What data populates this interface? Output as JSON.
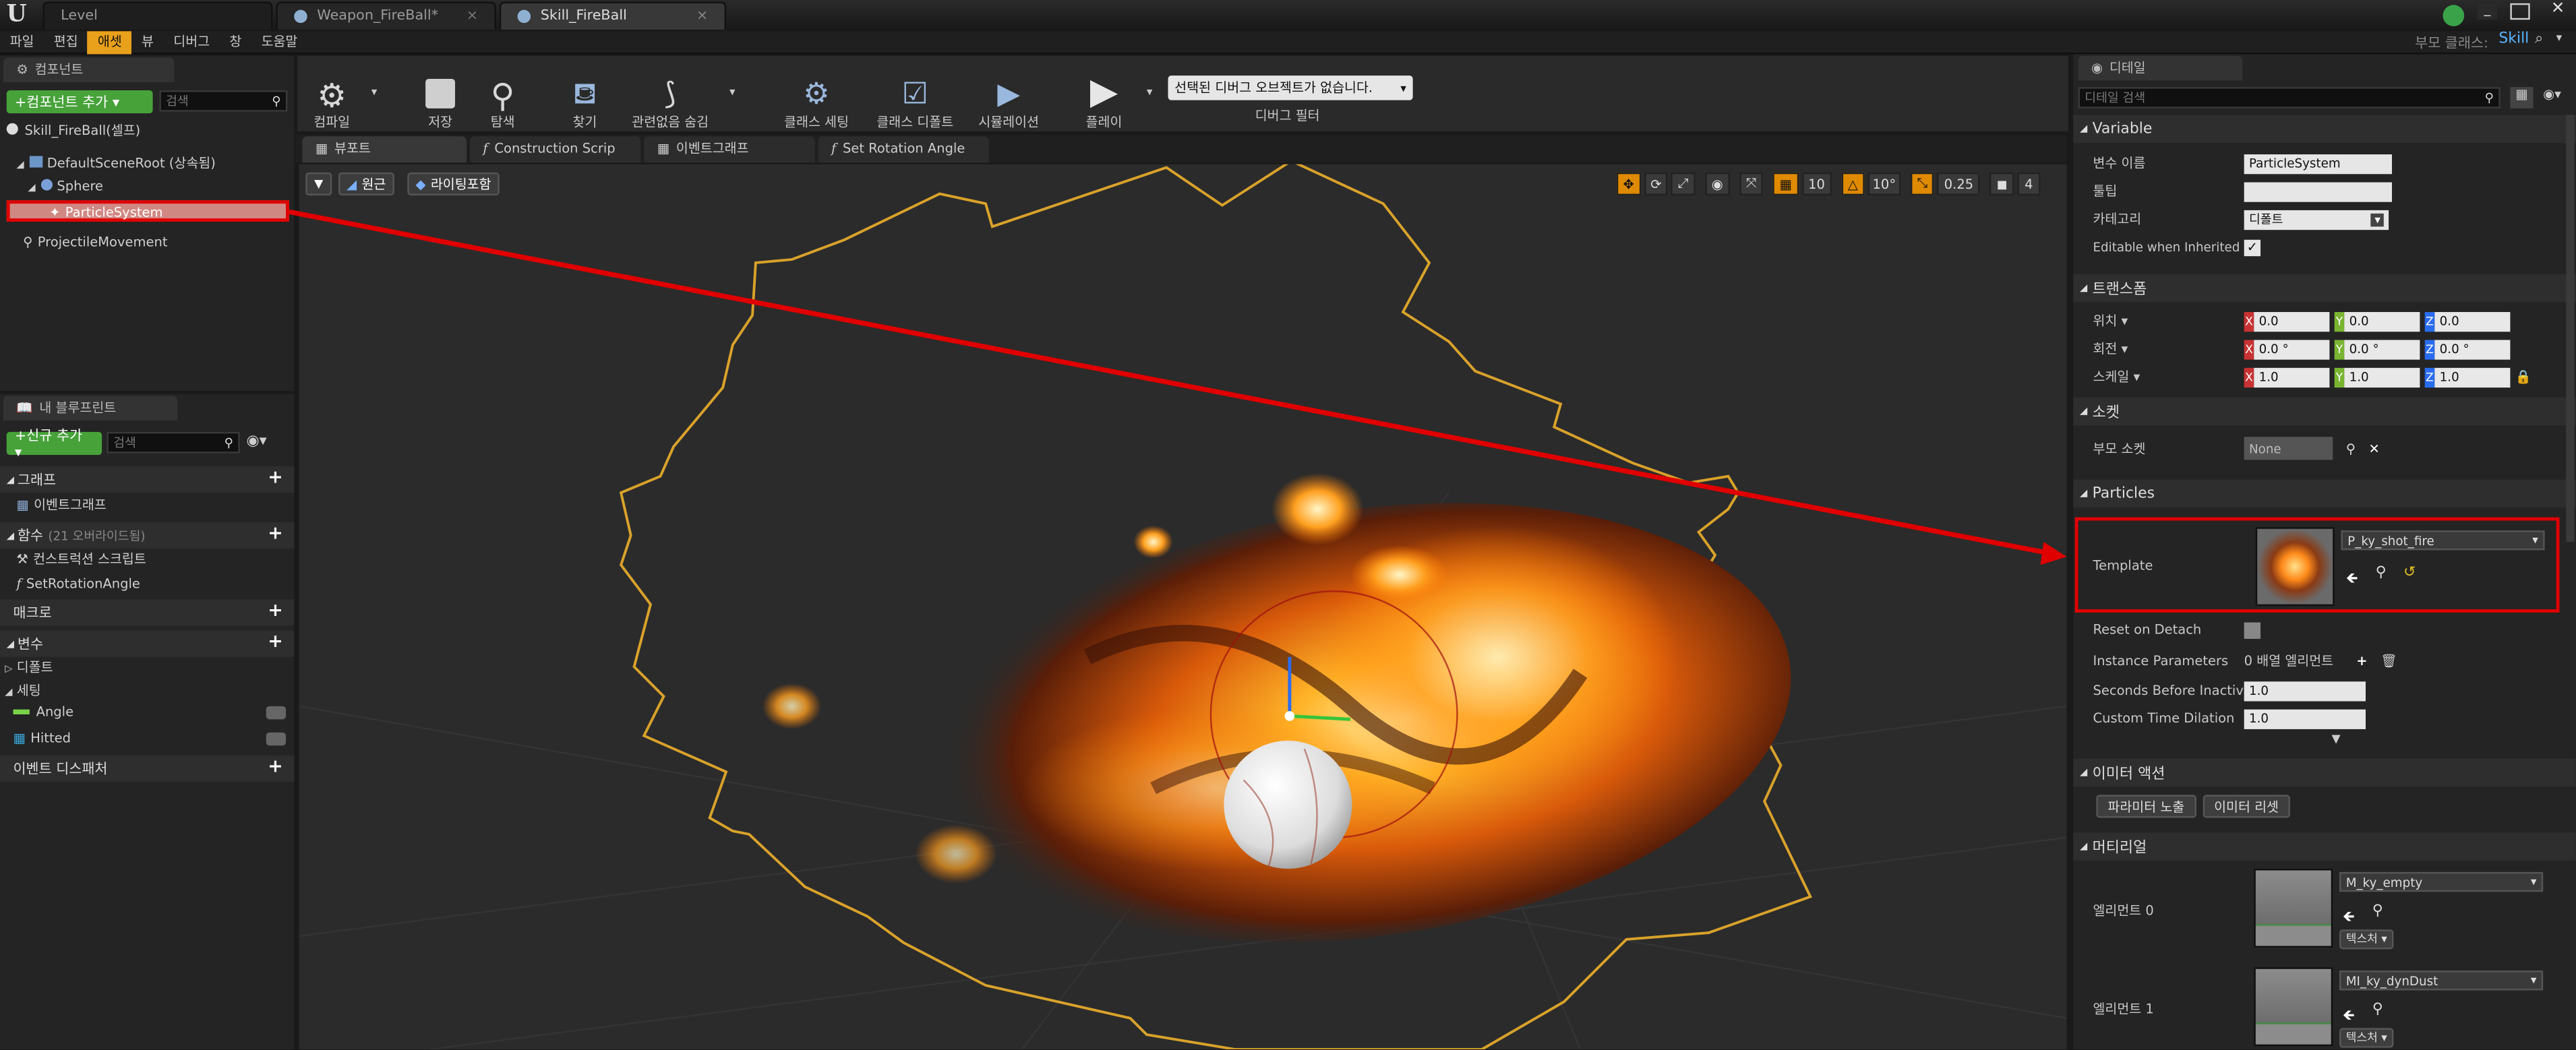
{
  "app": {
    "logo": "U"
  },
  "tabs": [
    {
      "label": "Level"
    },
    {
      "label": "Weapon_FireBall*"
    },
    {
      "label": "Skill_FireBall"
    }
  ],
  "window": {
    "parent_class_label": "부모 클래스:",
    "parent_class_value": "Skill"
  },
  "menu": [
    "파일",
    "편집",
    "애셋",
    "뷰",
    "디버그",
    "창",
    "도움말"
  ],
  "components": {
    "tab_label": "컴포넌트",
    "add_button": "+컴포넌트 추가 ▾",
    "search_placeholder": "검색",
    "self_item": "Skill_FireBall(셀프)",
    "tree": [
      "DefaultSceneRoot (상속됨)",
      "Sphere",
      "ParticleSystem",
      "ProjectileMovement"
    ]
  },
  "my_blueprint": {
    "tab_label": "내 블루프린트",
    "add_button": "+신규 추가 ▾",
    "search_placeholder": "검색",
    "graph_section": "그래프",
    "event_graph": "이벤트그래프",
    "functions_section": "함수",
    "functions_override": "(21 오버라이드됨)",
    "construction_script": "컨스트럭션 스크립트",
    "set_rotation_angle": "SetRotationAngle",
    "macros_section": "매크로",
    "variables_section": "변수",
    "default_category": "디폴트",
    "setting_category": "세팅",
    "vars": [
      "Angle",
      "Hitted"
    ],
    "dispatchers_section": "이벤트 디스패처"
  },
  "toolbar": {
    "compile": "컴파일",
    "save": "저장",
    "browse": "탐색",
    "find": "찾기",
    "hide_unrelated": "관련없음 숨김",
    "class_settings": "클래스 세팅",
    "class_defaults": "클래스 디폴트",
    "simulation": "시뮬레이션",
    "play": "플레이",
    "debug_select": "선택된 디버그 오브젝트가 없습니다.",
    "debug_filter": "디버그 필터"
  },
  "editor_tabs": [
    "뷰포트",
    "Construction Scrip",
    "이벤트그래프",
    "Set Rotation Angle"
  ],
  "viewport": {
    "perspective": "원근",
    "lit": "라이팅포함",
    "grid_snap": "10",
    "rot_snap": "10°",
    "scale_snap": "0.25",
    "cam_speed": "4"
  },
  "details": {
    "tab_label": "디테일",
    "search_placeholder": "디테일 검색",
    "variable_section": "Variable",
    "var_name_label": "변수 이름",
    "var_name_value": "ParticleSystem",
    "tooltip_label": "툴팁",
    "category_label": "카테고리",
    "category_value": "디폴트",
    "editable_label": "Editable when Inherited",
    "transform_section": "트랜스폼",
    "location_label": "위치 ▾",
    "rotation_label": "회전 ▾",
    "scale_label": "스케일 ▾",
    "location": [
      "0.0",
      "0.0",
      "0.0"
    ],
    "rotation": [
      "0.0 °",
      "0.0 °",
      "0.0 °"
    ],
    "scale": [
      "1.0",
      "1.0",
      "1.0"
    ],
    "socket_section": "소켓",
    "parent_socket_label": "부모 소켓",
    "parent_socket_value": "None",
    "particles_section": "Particles",
    "template_label": "Template",
    "template_value": "P_ky_shot_fire",
    "reset_detach_label": "Reset on Detach",
    "instance_params_label": "Instance Parameters",
    "instance_params_value": "0 배열 엘리먼트",
    "seconds_inactive_label": "Seconds Before Inactive",
    "seconds_inactive_value": "1.0",
    "time_dilation_label": "Custom Time Dilation",
    "time_dilation_value": "1.0",
    "emitter_section": "이미터 액션",
    "expose_params": "파라미터 노출",
    "reset_emitter": "이미터 리셋",
    "material_section": "머티리얼",
    "element0_label": "엘리먼트 0",
    "element0_value": "M_ky_empty",
    "element1_label": "엘리먼트 1",
    "element1_value": "MI_ky_dynDust",
    "texture_btn": "텍스처 ▾"
  },
  "colors": {
    "accent": "#e9a11b",
    "highlight": "#e00000",
    "green": "#47a23a",
    "bounds": "#d9a22b"
  }
}
